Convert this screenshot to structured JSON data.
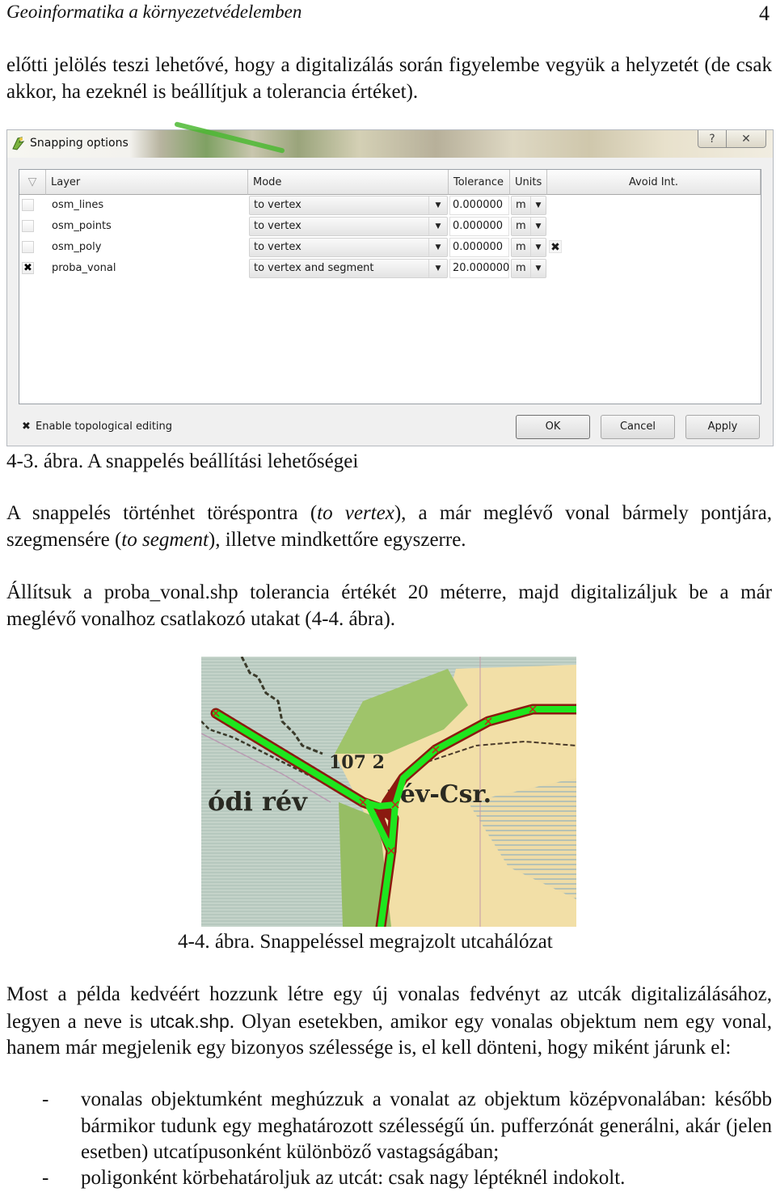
{
  "header": {
    "running_title": "Geoinformatika a környezetvédelemben",
    "page_number": "4"
  },
  "intro_paragraph": "előtti jelölés teszi lehetővé, hogy a digitalizálás során figyelembe vegyük a helyzetét (de csak akkor, ha ezeknél is beállítjuk a tolerancia értéket).",
  "dialog": {
    "title": "Snapping options",
    "app_icon": "qgis-icon",
    "help_icon": "?",
    "close_icon": "✕",
    "columns": {
      "sort": "▽",
      "layer": "Layer",
      "mode": "Mode",
      "tolerance": "Tolerance",
      "units": "Units",
      "avoid": "Avoid Int."
    },
    "rows": [
      {
        "checked": false,
        "layer": "osm_lines",
        "mode": "to vertex",
        "tolerance": "0.000000",
        "units": "m",
        "avoid_intersections": false
      },
      {
        "checked": false,
        "layer": "osm_points",
        "mode": "to vertex",
        "tolerance": "0.000000",
        "units": "m",
        "avoid_intersections": false
      },
      {
        "checked": false,
        "layer": "osm_poly",
        "mode": "to vertex",
        "tolerance": "0.000000",
        "units": "m",
        "avoid_intersections": true
      },
      {
        "checked": true,
        "layer": "proba_vonal",
        "mode": "to vertex and segment",
        "tolerance": "20.000000",
        "units": "m",
        "avoid_intersections": false
      }
    ],
    "check_mark": "✖",
    "dropdown_arrow": "▼",
    "topological_editing": {
      "checked": true,
      "label": "Enable topological editing"
    },
    "buttons": {
      "ok": "OK",
      "cancel": "Cancel",
      "apply": "Apply"
    }
  },
  "caption_1": "4-3. ábra. A snappelés beállítási lehetőségei",
  "para_2": {
    "p1": "A snappelés történhet töréspontra (",
    "em1": "to vertex",
    "p2": "), a már meglévő vonal bármely pontjára, szegmensére (",
    "em2": "to segment",
    "p3": "), illetve mindkettőre egyszerre."
  },
  "para_3": "Állítsuk a proba_vonal.shp tolerancia értékét 20 méterre, majd digitalizáljuk be a már meglévő vonalhoz csatlakozó utakat (4-4. ábra).",
  "map": {
    "labels": {
      "left": "ódi rév",
      "right": "rév-Csr.",
      "number": "107 2"
    },
    "colors": {
      "water": "#c3d2c9",
      "forest": "#9fc46a",
      "settlement": "#f3dfa6",
      "road_digitized": "#1ee61e",
      "road_edge": "#8b1a10"
    }
  },
  "caption_2": "4-4. ábra. Snappeléssel megrajzolt utcahálózat",
  "para_4": {
    "p1": "Most a példa kedvéért hozzunk létre egy új vonalas fedvényt az utcák digitalizálásához, legyen a neve is ",
    "code": "utcak.shp",
    "p2": ". Olyan esetekben, amikor egy vonalas objektum nem egy vonal, hanem már megjelenik egy bizonyos szélessége is, el kell dönteni, hogy miként járunk el:"
  },
  "bullets": [
    {
      "dash": "-",
      "text": "vonalas objektumként meghúzzuk a vonalat az objektum középvonalában: később bármikor tudunk egy meghatározott szélességű ún. pufferzónát generálni, akár (jelen esetben) utcatípusonként különböző vastagságában;"
    },
    {
      "dash": "-",
      "text": "poligonként körbehatároljuk az utcát: csak nagy léptéknél indokolt."
    }
  ]
}
